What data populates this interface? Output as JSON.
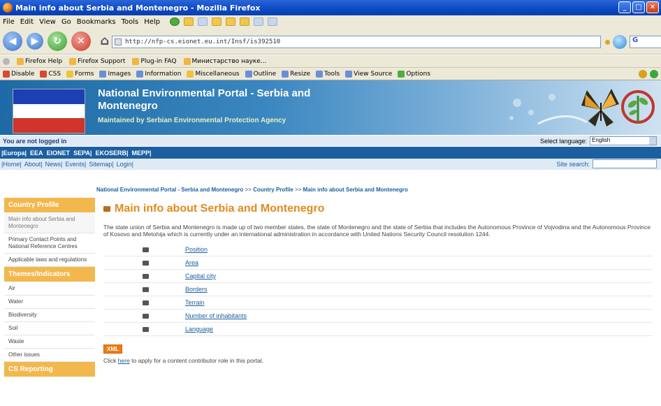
{
  "window": {
    "title": "Main info about Serbia and Montenegro - Mozilla Firefox"
  },
  "menu": [
    "File",
    "Edit",
    "View",
    "Go",
    "Bookmarks",
    "Tools",
    "Help"
  ],
  "address": {
    "url": "http://nfp-cs.eionet.eu.int/Insf/is392510"
  },
  "search_engine_label": "G",
  "bookmarks": [
    "Firefox Help",
    "Firefox Support",
    "Plug-in FAQ",
    "Министарство науке..."
  ],
  "devtools": [
    "Disable",
    "CSS",
    "Forms",
    "Images",
    "Information",
    "Miscellaneous",
    "Outline",
    "Resize",
    "Tools",
    "View Source",
    "Options"
  ],
  "banner": {
    "title": "National Environmental Portal - Serbia and Montenegro",
    "subtitle": "Maintained by Serbian Environmental Protection Agency"
  },
  "login_status": "You are not logged in",
  "language": {
    "label": "Select language:",
    "selected": "English"
  },
  "top_links": [
    "|Europa|",
    "EEA",
    "EIONET",
    "SEPA|",
    "EKOSERB|",
    "MEPP|"
  ],
  "nav_links": [
    "|Home|",
    "About|",
    "News|",
    "Events|",
    "Sitemap|",
    "Login|"
  ],
  "site_search_label": "Site search:",
  "breadcrumb": {
    "item1": "National Environmental Portal - Serbia and Montenegro",
    "sep": ">>",
    "item2": "Country Profile",
    "item3": "Main info about Serbia and Montenegro"
  },
  "sidebar": {
    "country_profile": {
      "heading": "Country Profile",
      "items": [
        "Main info about Serbia and Montenegro",
        "Primary Contact Points and National Reference Centres",
        "Applicable laws and regulations"
      ]
    },
    "themes": {
      "heading": "Themes/Indicators",
      "items": [
        "Air",
        "Water",
        "Biodiversity",
        "Soil",
        "Waste",
        "Other issues"
      ]
    },
    "reporting": {
      "heading": "CS Reporting"
    }
  },
  "main": {
    "heading": "Main info about Serbia and Montenegro",
    "intro": "The state union of Serbia and Montenegro is made up of two member states, the state of Montenegro and the state of Serbia that includes the Autonomous Province of Vojvodina and the Autonomous Province of Kosovo and Metohija which is currently under an international administration in accordance with United Nations Security Council resolution 1244.",
    "toc": [
      "Position",
      "Area",
      "Capital city",
      "Borders",
      "Terrain",
      "Number of inhabitants",
      "Language"
    ],
    "xml_badge": "XML",
    "apply_before": "Click ",
    "apply_link": "here",
    "apply_after": " to apply for a content contributor role in this portal."
  },
  "colors": {
    "accent_orange": "#e28a1e",
    "sidebar_orange": "#f2b84d",
    "link_blue": "#1c5fa0",
    "banner_blue": "#1e6aa6"
  }
}
